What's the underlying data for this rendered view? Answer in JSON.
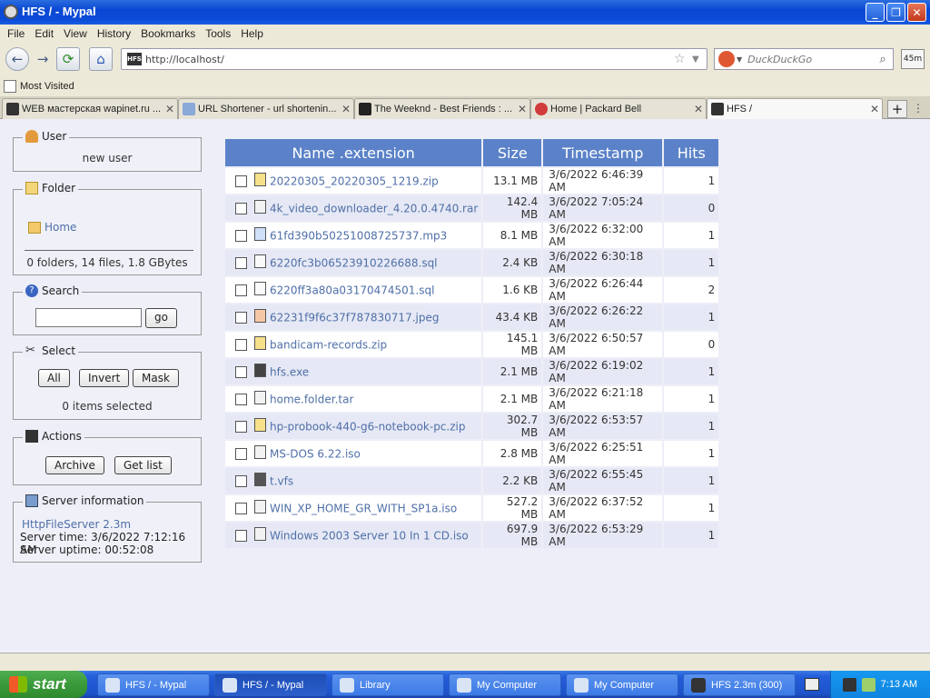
{
  "window": {
    "title": "HFS / - Mypal"
  },
  "menu": [
    "File",
    "Edit",
    "View",
    "History",
    "Bookmarks",
    "Tools",
    "Help"
  ],
  "nav": {
    "url": "http://localhost/",
    "search_placeholder": "DuckDuckGo",
    "addon_label": "45m"
  },
  "bookmarks": {
    "most_visited": "Most Visited"
  },
  "tabs": [
    {
      "label": "WEB мастерская wapinet.ru ..."
    },
    {
      "label": "URL Shortener - url shortenin..."
    },
    {
      "label": "The Weeknd - Best Friends : ..."
    },
    {
      "label": "Home | Packard Bell"
    },
    {
      "label": "HFS /"
    }
  ],
  "sidebar": {
    "user": {
      "legend": "User",
      "name": "new user"
    },
    "folder": {
      "legend": "Folder",
      "home": "Home",
      "summary": "0 folders, 14 files, 1.8 GBytes"
    },
    "search": {
      "legend": "Search",
      "go": "go"
    },
    "select": {
      "legend": "Select",
      "all": "All",
      "invert": "Invert",
      "mask": "Mask",
      "status": "0 items selected"
    },
    "actions": {
      "legend": "Actions",
      "archive": "Archive",
      "getlist": "Get list"
    },
    "server": {
      "legend": "Server information",
      "name": "HttpFileServer 2.3m",
      "time": "Server time: 3/6/2022 7:12:16 AM",
      "uptime": "Server uptime: 00:52:08"
    }
  },
  "table": {
    "headers": {
      "name": "Name .extension",
      "size": "Size",
      "timestamp": "Timestamp",
      "hits": "Hits"
    },
    "rows": [
      {
        "name": "20220305_20220305_1219.zip",
        "size": "13.1 MB",
        "ts": "3/6/2022 6:46:39 AM",
        "hits": "1",
        "icon": "zip"
      },
      {
        "name": "4k_video_downloader_4.20.0.4740.rar",
        "size": "142.4 MB",
        "ts": "3/6/2022 7:05:24 AM",
        "hits": "0",
        "icon": "file"
      },
      {
        "name": "61fd390b50251008725737.mp3",
        "size": "8.1 MB",
        "ts": "3/6/2022 6:32:00 AM",
        "hits": "1",
        "icon": "audio"
      },
      {
        "name": "6220fc3b06523910226688.sql",
        "size": "2.4 KB",
        "ts": "3/6/2022 6:30:18 AM",
        "hits": "1",
        "icon": "text"
      },
      {
        "name": "6220ff3a80a03170474501.sql",
        "size": "1.6 KB",
        "ts": "3/6/2022 6:26:44 AM",
        "hits": "2",
        "icon": "text"
      },
      {
        "name": "62231f9f6c37f787830717.jpeg",
        "size": "43.4 KB",
        "ts": "3/6/2022 6:26:22 AM",
        "hits": "1",
        "icon": "image"
      },
      {
        "name": "bandicam-records.zip",
        "size": "145.1 MB",
        "ts": "3/6/2022 6:50:57 AM",
        "hits": "0",
        "icon": "zip"
      },
      {
        "name": "hfs.exe",
        "size": "2.1 MB",
        "ts": "3/6/2022 6:19:02 AM",
        "hits": "1",
        "icon": "exe"
      },
      {
        "name": "home.folder.tar",
        "size": "2.1 MB",
        "ts": "3/6/2022 6:21:18 AM",
        "hits": "1",
        "icon": "file"
      },
      {
        "name": "hp-probook-440-g6-notebook-pc.zip",
        "size": "302.7 MB",
        "ts": "3/6/2022 6:53:57 AM",
        "hits": "1",
        "icon": "zip"
      },
      {
        "name": "MS-DOS 6.22.iso",
        "size": "2.8 MB",
        "ts": "3/6/2022 6:25:51 AM",
        "hits": "1",
        "icon": "file"
      },
      {
        "name": "t.vfs",
        "size": "2.2 KB",
        "ts": "3/6/2022 6:55:45 AM",
        "hits": "1",
        "icon": "vfs"
      },
      {
        "name": "WIN_XP_HOME_GR_WITH_SP1a.iso",
        "size": "527.2 MB",
        "ts": "3/6/2022 6:37:52 AM",
        "hits": "1",
        "icon": "file"
      },
      {
        "name": "Windows 2003 Server 10 In 1 CD.iso",
        "size": "697.9 MB",
        "ts": "3/6/2022 6:53:29 AM",
        "hits": "1",
        "icon": "file"
      }
    ]
  },
  "taskbar": {
    "start": "start",
    "items": [
      {
        "label": "HFS / - Mypal"
      },
      {
        "label": "HFS / - Mypal"
      },
      {
        "label": "Library"
      },
      {
        "label": "My Computer"
      },
      {
        "label": "My Computer"
      },
      {
        "label": "HFS 2.3m (300)"
      }
    ],
    "clock": "7:13 AM"
  }
}
